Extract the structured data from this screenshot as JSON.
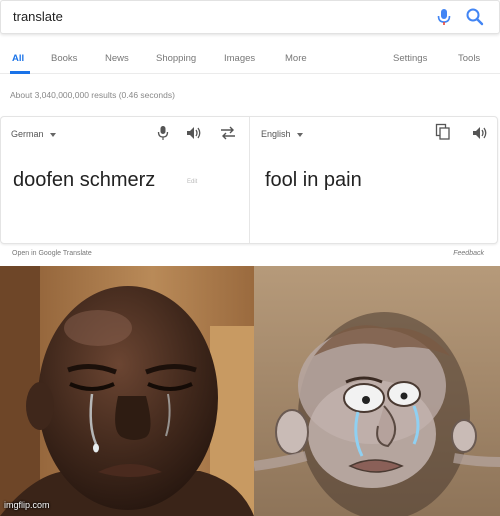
{
  "search": {
    "query": "translate"
  },
  "tabs": {
    "all": "All",
    "books": "Books",
    "news": "News",
    "shopping": "Shopping",
    "images": "Images",
    "more": "More",
    "settings": "Settings",
    "tools": "Tools"
  },
  "results": {
    "count_text": "About 3,040,000,000 results (0.46 seconds)"
  },
  "translate": {
    "source_language": "German",
    "target_language": "English",
    "source_text": "doofen schmerz",
    "edit_label": "Edit",
    "target_text": "fool in pain",
    "open_link": "Open in Google Translate",
    "feedback": "Feedback"
  },
  "meme": {
    "watermark": "imgflip.com"
  },
  "colors": {
    "accent": "#1a73e8",
    "mic_blue": "#4285f4"
  },
  "icons": [
    "mic-icon",
    "search-icon",
    "speaker-icon",
    "swap-icon",
    "copy-icon"
  ]
}
